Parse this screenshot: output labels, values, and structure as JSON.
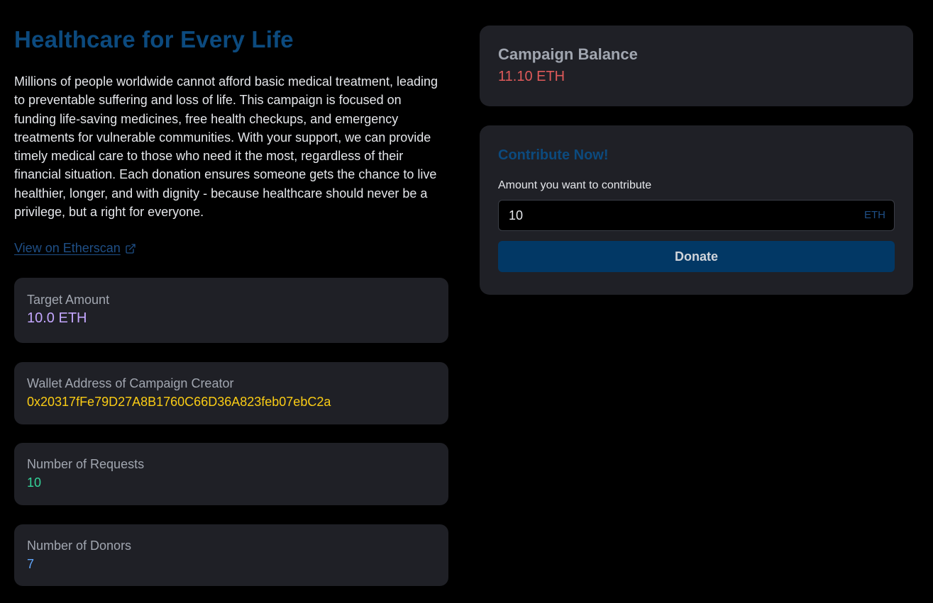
{
  "campaign": {
    "title": "Healthcare for Every Life",
    "description": "Millions of people worldwide cannot afford basic medical treatment, leading to preventable suffering and loss of life. This campaign is focused on funding life-saving medicines, free health checkups, and emergency treatments for vulnerable communities. With your support, we can provide timely medical care to those who need it the most, regardless of their financial situation. Each donation ensures someone gets the chance to live healthier, longer, and with dignity - because healthcare should never be a privilege, but a right for everyone.",
    "etherscan_link": "View on Etherscan"
  },
  "stats": [
    {
      "label": "Target Amount",
      "value": "10.0 ETH",
      "color": "#c4a7ff"
    },
    {
      "label": "Wallet Address of Campaign Creator",
      "value": "0x20317fFe79D27A8B1760C66D36A823feb07ebC2a",
      "color": "#facc15"
    },
    {
      "label": "Number of Requests",
      "value": "10",
      "color": "#34d399"
    },
    {
      "label": "Number of Donors",
      "value": "7",
      "color": "#60a5fa"
    }
  ],
  "balance": {
    "title": "Campaign Balance",
    "value": "11.10 ETH"
  },
  "contribute": {
    "title": "Contribute Now!",
    "amount_label": "Amount you want to contribute",
    "amount_value": "10",
    "unit": "ETH",
    "donate_label": "Donate"
  },
  "icons": {
    "external_link": "external-link-icon"
  }
}
